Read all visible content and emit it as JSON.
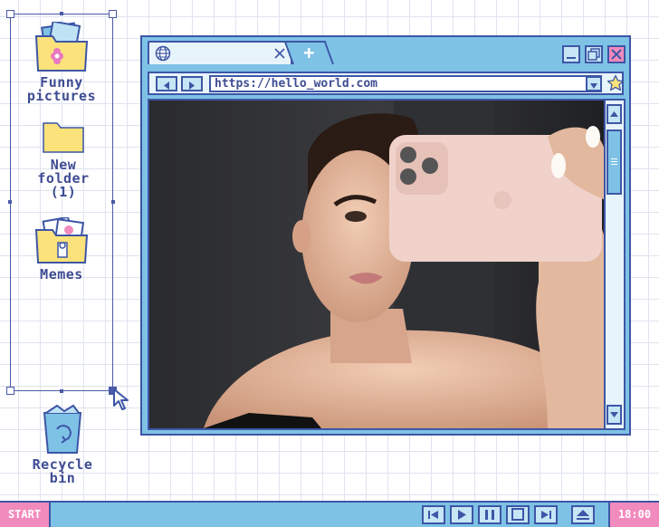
{
  "desktop": {
    "icons": [
      {
        "label": "Funny\npictures",
        "icon": "folder-with-flower-icon"
      },
      {
        "label": "New\nfolder\n(1)",
        "icon": "folder-icon"
      },
      {
        "label": "Memes",
        "icon": "folder-with-memes-icon"
      },
      {
        "label": "Recycle\nbin",
        "icon": "recycle-bin-icon"
      }
    ]
  },
  "browser": {
    "tab_close_icon": "close-icon",
    "new_tab_label": "+",
    "url": "https://hello_world.com",
    "favorite_icon": "star-icon"
  },
  "taskbar": {
    "start_label": "START",
    "clock": "18:00",
    "media_buttons": [
      "skip-back-icon",
      "play-icon",
      "pause-icon",
      "stop-icon",
      "skip-forward-icon",
      "eject-icon"
    ]
  },
  "colors": {
    "accent_blue": "#7ec2e6",
    "border_navy": "#3d56a6",
    "pink": "#f28bbd",
    "label": "#3e4c93"
  }
}
